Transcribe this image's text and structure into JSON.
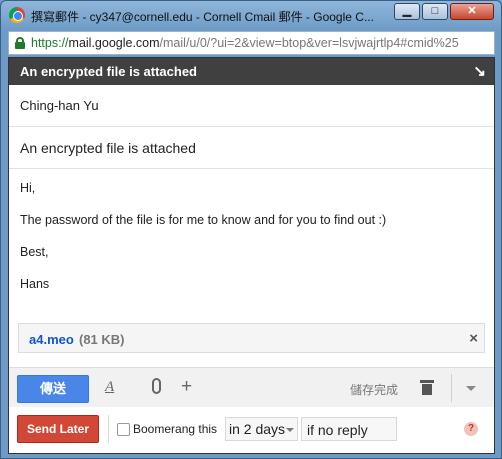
{
  "window": {
    "title": "撰寫郵件 - cy347@cornell.edu - Cornell Cmail 郵件 - Google C...",
    "minimize_glyph": "▁",
    "maximize_glyph": "□",
    "close_glyph": "✕"
  },
  "address_bar": {
    "scheme": "https://",
    "host": "mail.google.com",
    "path": "/mail/u/0/?ui=2&view=btop&ver=lsvjwajrtlp4#cmid%25"
  },
  "compose": {
    "header_title": "An encrypted file is attached",
    "to": "Ching-han Yu",
    "subject": "An encrypted file is attached",
    "body_lines": [
      "Hi,",
      "The password of the file is for me to know and for you to find out :)",
      "Best,",
      "Hans"
    ],
    "attachment": {
      "name": "a4.meo",
      "size": "(81 KB)"
    }
  },
  "toolbar": {
    "send_label": "傳送",
    "format_glyph": "A",
    "more_glyph": "+",
    "draft_status": "儲存完成"
  },
  "boomerang": {
    "send_later_label": "Send Later",
    "checkbox_label": "Boomerang this",
    "checked": false,
    "delay_value": "in 2 days",
    "condition_value": "if no reply"
  }
}
